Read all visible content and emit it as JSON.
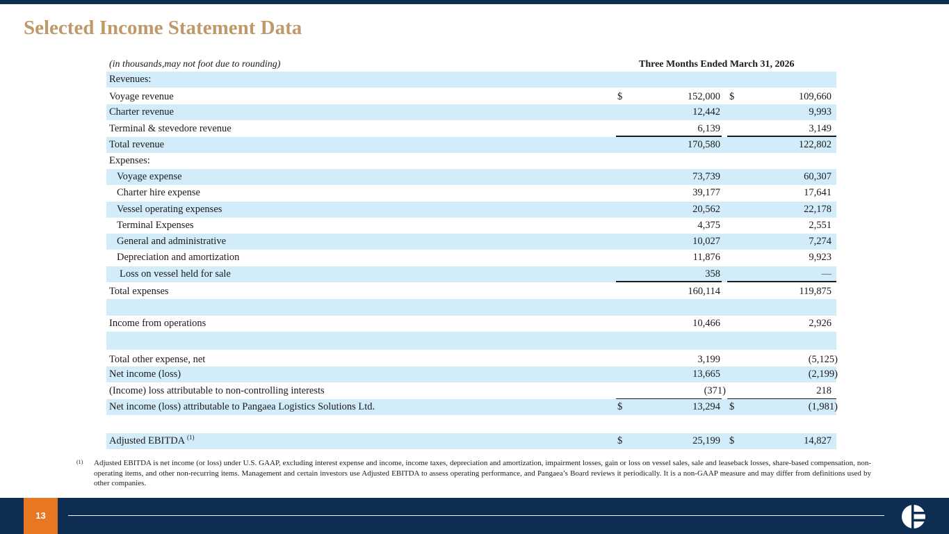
{
  "title": "Selected Income Statement Data",
  "table": {
    "subtitle": "(in thousands,may not foot due to rounding)",
    "period_header": "Three Months Ended March 31, 2026",
    "rows": [
      {
        "label": "Revenues:",
        "v1": "",
        "v2": "",
        "dollar": false
      },
      {
        "label": "Voyage revenue",
        "v1": "152,000",
        "v2": "109,660",
        "dollar": true
      },
      {
        "label": "Charter revenue",
        "v1": "12,442",
        "v2": "9,993",
        "dollar": false
      },
      {
        "label": "Terminal & stevedore revenue",
        "v1": "6,139",
        "v2": "3,149",
        "dollar": false
      },
      {
        "label": "Total revenue",
        "v1": "170,580",
        "v2": "122,802",
        "dollar": false
      },
      {
        "label": "Expenses:",
        "v1": "",
        "v2": "",
        "dollar": false
      },
      {
        "label": "Voyage expense",
        "v1": "73,739",
        "v2": "60,307",
        "dollar": false
      },
      {
        "label": "Charter hire expense",
        "v1": "39,177",
        "v2": "17,641",
        "dollar": false
      },
      {
        "label": "Vessel operating expenses",
        "v1": "20,562",
        "v2": "22,178",
        "dollar": false
      },
      {
        "label": "Terminal Expenses",
        "v1": "4,375",
        "v2": "2,551",
        "dollar": false
      },
      {
        "label": "General and administrative",
        "v1": "10,027",
        "v2": "7,274",
        "dollar": false
      },
      {
        "label": "Depreciation and amortization",
        "v1": "11,876",
        "v2": "9,923",
        "dollar": false
      },
      {
        "label": "Loss on vessel held for sale",
        "v1": "358",
        "v2": "—",
        "dollar": false
      },
      {
        "label": "Total expenses",
        "v1": "160,114",
        "v2": "119,875",
        "dollar": false
      },
      {
        "label": "",
        "v1": "",
        "v2": "",
        "dollar": false
      },
      {
        "label": "Income from operations",
        "v1": "10,466",
        "v2": "2,926",
        "dollar": false
      },
      {
        "label": "",
        "v1": "",
        "v2": "",
        "dollar": false
      },
      {
        "label": "Total other expense, net",
        "v1": "3,199",
        "v2": "(5,125)",
        "dollar": false
      },
      {
        "label": "Net income (loss)",
        "v1": "13,665",
        "v2": "(2,199)",
        "dollar": false
      },
      {
        "label": "(Income) loss attributable to non-controlling interests",
        "v1": "(371)",
        "v2": "218",
        "dollar": false
      },
      {
        "label": "Net income (loss) attributable to Pangaea Logistics Solutions Ltd.",
        "v1": "13,294",
        "v2": "(1,981)",
        "dollar": true
      },
      {
        "label": "",
        "v1": "",
        "v2": "",
        "dollar": false
      },
      {
        "label": "Adjusted EBITDA",
        "sup": "(1)",
        "v1": "25,199",
        "v2": "14,827",
        "dollar": true
      }
    ],
    "dollar_sign": "$"
  },
  "footnote": {
    "marker": "(1)",
    "text": "Adjusted EBITDA is net income (or loss) under U.S. GAAP, excluding interest expense and income, income taxes, depreciation and amortization, impairment losses, gain or loss on vessel sales, sale and leaseback losses, share-based compensation, non-operating items, and other non-recurring items. Management and certain investors use Adjusted EBITDA to assess operating performance, and Pangaea’s Board reviews it periodically. It is a non-GAAP measure and may differ from definitions used by other companies."
  },
  "footer": {
    "page_number": "13"
  },
  "colors": {
    "navy": "#0d2d52",
    "gold_title": "#c0996a",
    "row_shade": "#d3ecf9",
    "orange": "#e87722"
  },
  "icons": [
    "company-logo"
  ]
}
